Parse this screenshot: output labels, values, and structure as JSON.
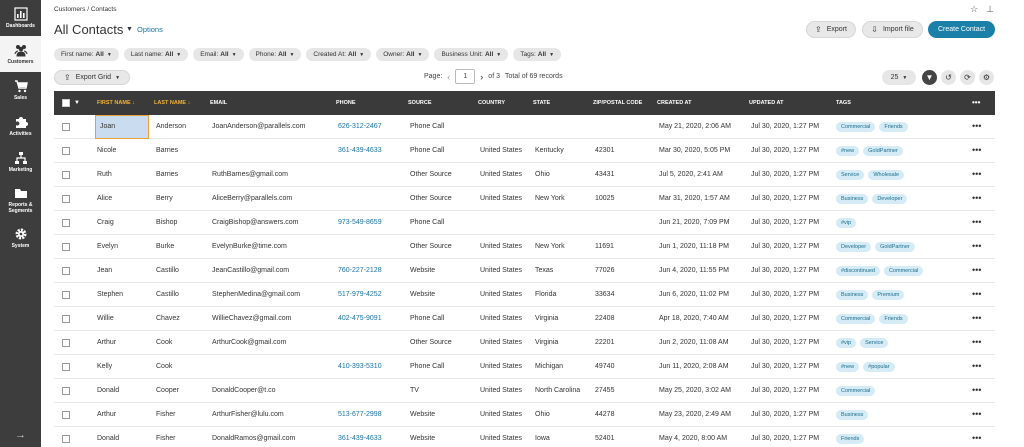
{
  "sidebar": {
    "items": [
      {
        "label": "Dashboards",
        "icon": "bar-chart-icon"
      },
      {
        "label": "Customers",
        "icon": "users-icon"
      },
      {
        "label": "Sales",
        "icon": "cart-icon"
      },
      {
        "label": "Activities",
        "icon": "puzzle-icon"
      },
      {
        "label": "Marketing",
        "icon": "network-icon"
      },
      {
        "label": "Reports & Segments",
        "icon": "folder-icon"
      },
      {
        "label": "System",
        "icon": "gear-icon"
      }
    ],
    "expand_icon": "arrow-right-icon"
  },
  "breadcrumb": "Customers / Contacts",
  "page_title": "All Contacts",
  "options_label": "Options",
  "actions": {
    "export": "Export",
    "import": "Import file",
    "create": "Create Contact"
  },
  "filters": [
    {
      "name": "First name:",
      "value": "All"
    },
    {
      "name": "Last name:",
      "value": "All"
    },
    {
      "name": "Email:",
      "value": "All"
    },
    {
      "name": "Phone:",
      "value": "All"
    },
    {
      "name": "Created At:",
      "value": "All"
    },
    {
      "name": "Owner:",
      "value": "All"
    },
    {
      "name": "Business Unit:",
      "value": "All"
    },
    {
      "name": "Tags:",
      "value": "All"
    }
  ],
  "export_grid": "Export Grid",
  "pager": {
    "page_label": "Page:",
    "current": "1",
    "of_label": "of 3",
    "total": "Total of 69 records"
  },
  "page_size": "25",
  "columns": {
    "first_name": "FIRST NAME",
    "last_name": "LAST NAME",
    "email": "EMAIL",
    "phone": "PHONE",
    "source": "SOURCE",
    "country": "COUNTRY",
    "state": "STATE",
    "zip": "ZIP/POSTAL CODE",
    "created": "CREATED AT",
    "updated": "UPDATED AT",
    "tags": "TAGS"
  },
  "rows": [
    {
      "first": "Joan",
      "last": "Anderson",
      "email": "JoanAnderson@parallels.com",
      "phone": "626-312-2467",
      "source": "Phone Call",
      "country": "",
      "state": "",
      "zip": "",
      "created": "May 21, 2020, 2:06 AM",
      "updated": "Jul 30, 2020, 1:27 PM",
      "tags": [
        "Commercial",
        "Friends"
      ]
    },
    {
      "first": "Nicole",
      "last": "Barnes",
      "email": "",
      "phone": "361-439-4633",
      "source": "Phone Call",
      "country": "United States",
      "state": "Kentucky",
      "zip": "42301",
      "created": "Mar 30, 2020, 5:05 PM",
      "updated": "Jul 30, 2020, 1:27 PM",
      "tags": [
        "#new",
        "GoldPartner"
      ]
    },
    {
      "first": "Ruth",
      "last": "Barnes",
      "email": "RuthBarnes@gmail.com",
      "phone": "",
      "source": "Other Source",
      "country": "United States",
      "state": "Ohio",
      "zip": "43431",
      "created": "Jul 5, 2020, 2:41 AM",
      "updated": "Jul 30, 2020, 1:27 PM",
      "tags": [
        "Service",
        "Wholesale"
      ]
    },
    {
      "first": "Alice",
      "last": "Berry",
      "email": "AliceBerry@parallels.com",
      "phone": "",
      "source": "Other Source",
      "country": "United States",
      "state": "New York",
      "zip": "10025",
      "created": "Mar 31, 2020, 1:57 AM",
      "updated": "Jul 30, 2020, 1:27 PM",
      "tags": [
        "Business",
        "Developer"
      ]
    },
    {
      "first": "Craig",
      "last": "Bishop",
      "email": "CraigBishop@answers.com",
      "phone": "973-549-8659",
      "source": "Phone Call",
      "country": "",
      "state": "",
      "zip": "",
      "created": "Jun 21, 2020, 7:09 PM",
      "updated": "Jul 30, 2020, 1:27 PM",
      "tags": [
        "#vip"
      ]
    },
    {
      "first": "Evelyn",
      "last": "Burke",
      "email": "EvelynBurke@time.com",
      "phone": "",
      "source": "Other Source",
      "country": "United States",
      "state": "New York",
      "zip": "11691",
      "created": "Jun 1, 2020, 11:18 PM",
      "updated": "Jul 30, 2020, 1:27 PM",
      "tags": [
        "Developer",
        "GoldPartner"
      ]
    },
    {
      "first": "Jean",
      "last": "Castillo",
      "email": "JeanCastillo@gmail.com",
      "phone": "760-227-2128",
      "source": "Website",
      "country": "United States",
      "state": "Texas",
      "zip": "77026",
      "created": "Jun 4, 2020, 11:55 PM",
      "updated": "Jul 30, 2020, 1:27 PM",
      "tags": [
        "#discontinued",
        "Commercial"
      ]
    },
    {
      "first": "Stephen",
      "last": "Castillo",
      "email": "StephenMedina@gmail.com",
      "phone": "517-979-4252",
      "source": "Website",
      "country": "United States",
      "state": "Florida",
      "zip": "33634",
      "created": "Jun 6, 2020, 11:02 PM",
      "updated": "Jul 30, 2020, 1:27 PM",
      "tags": [
        "Business",
        "Premium"
      ]
    },
    {
      "first": "Willie",
      "last": "Chavez",
      "email": "WillieChavez@gmail.com",
      "phone": "402-475-9091",
      "source": "Phone Call",
      "country": "United States",
      "state": "Virginia",
      "zip": "22408",
      "created": "Apr 18, 2020, 7:40 AM",
      "updated": "Jul 30, 2020, 1:27 PM",
      "tags": [
        "Commercial",
        "Friends"
      ]
    },
    {
      "first": "Arthur",
      "last": "Cook",
      "email": "ArthurCook@gmail.com",
      "phone": "",
      "source": "Other Source",
      "country": "United States",
      "state": "Virginia",
      "zip": "22201",
      "created": "Jun 2, 2020, 11:08 AM",
      "updated": "Jul 30, 2020, 1:27 PM",
      "tags": [
        "#vip",
        "Service"
      ]
    },
    {
      "first": "Kelly",
      "last": "Cook",
      "email": "",
      "phone": "410-393-5310",
      "source": "Phone Call",
      "country": "United States",
      "state": "Michigan",
      "zip": "49740",
      "created": "Jun 11, 2020, 2:08 AM",
      "updated": "Jul 30, 2020, 1:27 PM",
      "tags": [
        "#new",
        "#popular"
      ]
    },
    {
      "first": "Donald",
      "last": "Cooper",
      "email": "DonaldCooper@t.co",
      "phone": "",
      "source": "TV",
      "country": "United States",
      "state": "North Carolina",
      "zip": "27455",
      "created": "May 25, 2020, 3:02 AM",
      "updated": "Jul 30, 2020, 1:27 PM",
      "tags": [
        "Commercial"
      ]
    },
    {
      "first": "Arthur",
      "last": "Fisher",
      "email": "ArthurFisher@lulu.com",
      "phone": "513-677-2998",
      "source": "Website",
      "country": "United States",
      "state": "Ohio",
      "zip": "44278",
      "created": "May 23, 2020, 2:49 AM",
      "updated": "Jul 30, 2020, 1:27 PM",
      "tags": [
        "Business"
      ]
    },
    {
      "first": "Donald",
      "last": "Fisher",
      "email": "DonaldRamos@gmail.com",
      "phone": "361-439-4633",
      "source": "Website",
      "country": "United States",
      "state": "Iowa",
      "zip": "52401",
      "created": "May 4, 2020, 8:00 AM",
      "updated": "Jul 30, 2020, 1:27 PM",
      "tags": [
        "Friends"
      ]
    }
  ]
}
